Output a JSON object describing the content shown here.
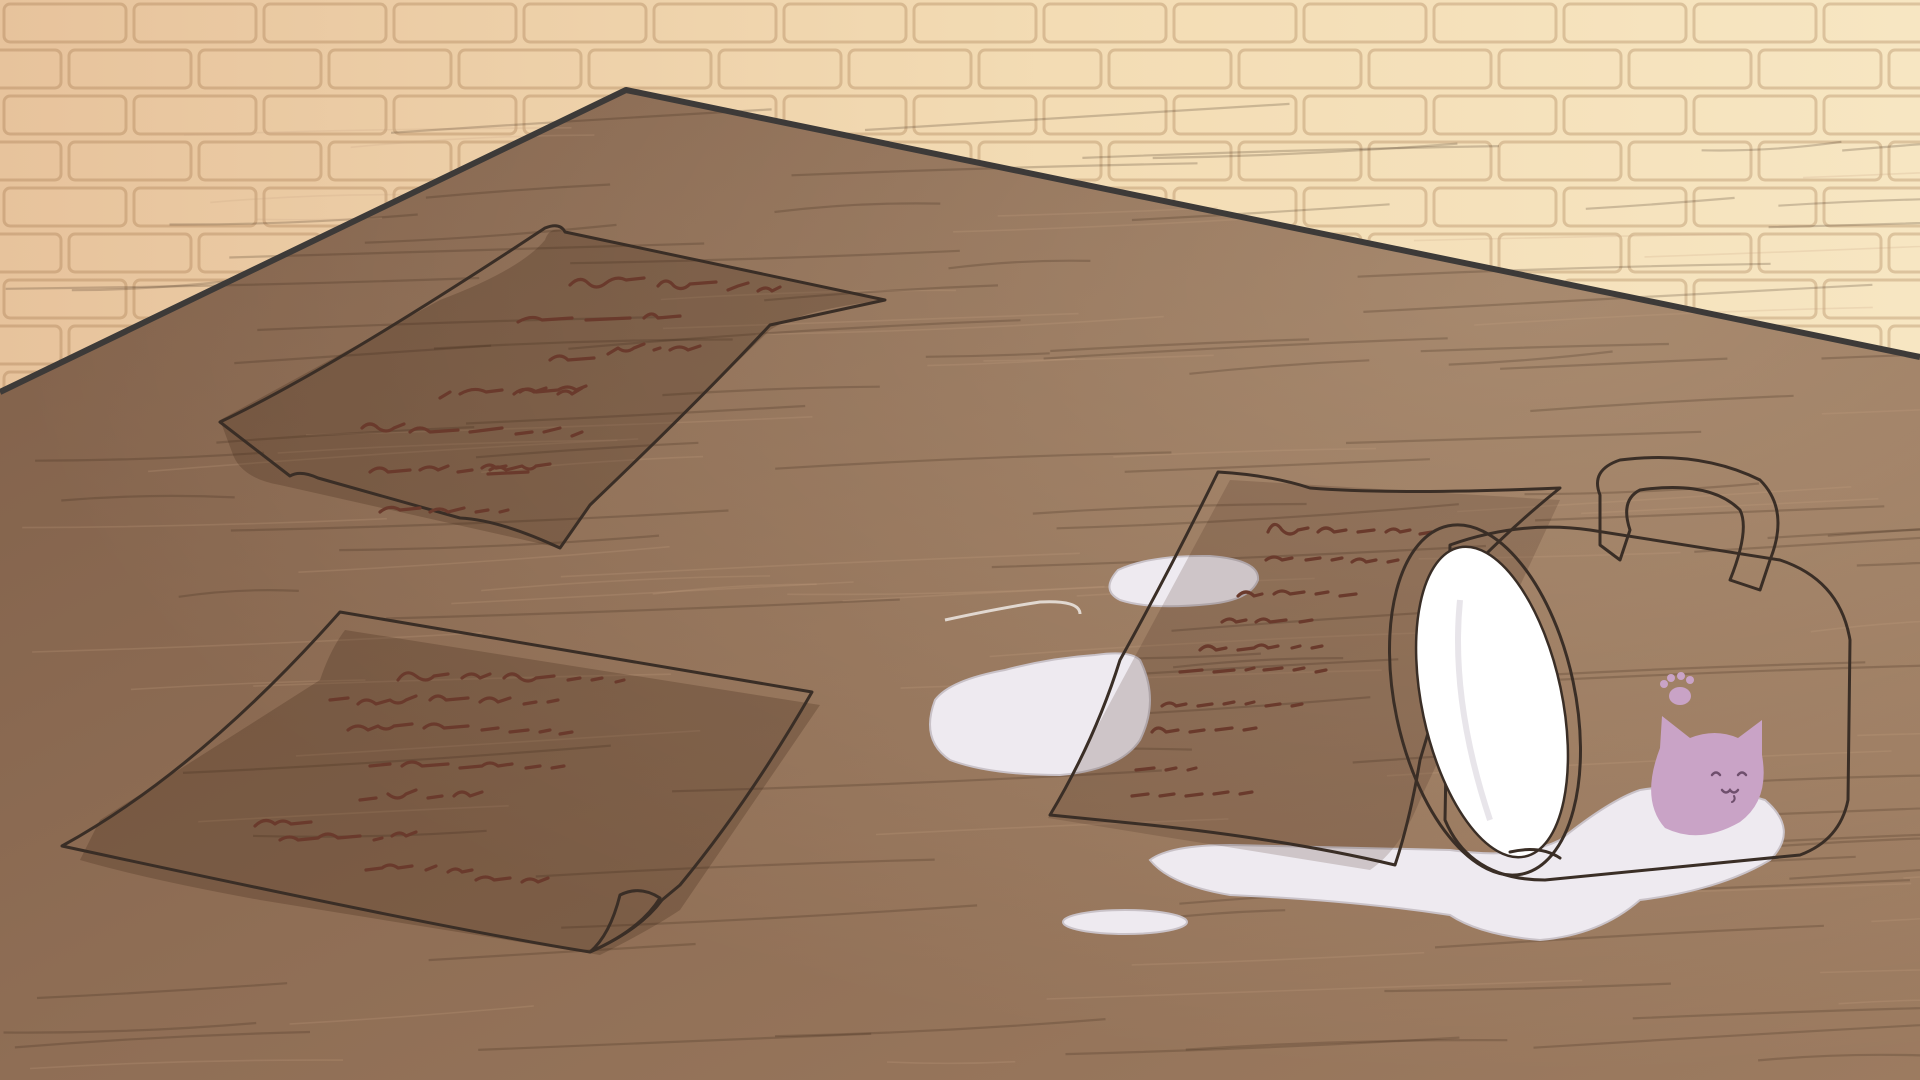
{
  "scene": {
    "wall_color": "#f0d8b0",
    "wall_brick_mortar": "#d9b386",
    "table_top_color": "#8a6a52",
    "table_edge_color": "#3a3a3a",
    "yellow_note_color": "#e2e07a",
    "green_note_color": "#90c97a",
    "red_note_color": "#b5696a",
    "mug_color": "#f3eef2",
    "spill_color": "#eeeaf0",
    "mug_cat_color": "#c9a3c6",
    "handwriting_color": "#6a3a2c"
  },
  "objects": {
    "yellow_note": "yellow-note",
    "green_note": "green-note",
    "red_note": "red-note",
    "mug": "cat-mug",
    "spill": "spilled-milk"
  }
}
